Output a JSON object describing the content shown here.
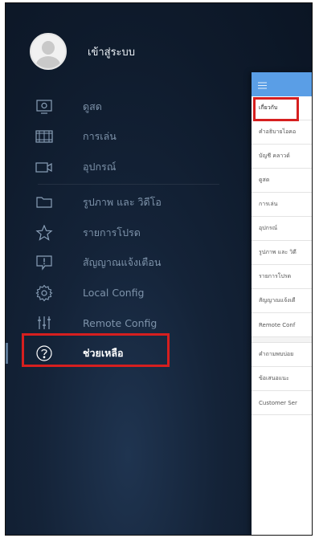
{
  "profile": {
    "login_label": "เข้าสู่ระบบ"
  },
  "menu": {
    "items": [
      {
        "label": "ดูสด",
        "icon": "monitor-icon"
      },
      {
        "label": "การเล่น",
        "icon": "film-icon"
      },
      {
        "label": "อุปกรณ์",
        "icon": "camera-icon"
      },
      {
        "label": "รูปภาพ และ วิดีโอ",
        "icon": "folder-icon"
      },
      {
        "label": "รายการโปรด",
        "icon": "star-icon"
      },
      {
        "label": "สัญญาณแจ้งเตือน",
        "icon": "alert-icon"
      },
      {
        "label": "Local Config",
        "icon": "gear-icon"
      },
      {
        "label": "Remote Config",
        "icon": "sliders-icon"
      },
      {
        "label": "ช่วยเหลือ",
        "icon": "help-icon"
      }
    ]
  },
  "help_panel": {
    "header_icon": "hamburger-icon",
    "items": [
      "เกี่ยวกับ",
      "คำอธิบายไอคอ",
      "บัญชี คลาวด์",
      "ดูสด",
      "การเล่น",
      "อุปกรณ์",
      "รูปภาพ และ วิดี",
      "รายการโปรด",
      "สัญญาณแจ้งเตื",
      "Remote Conf",
      "คำถามพบบ่อย",
      "ข้อเสนอแนะ",
      "Customer Ser"
    ]
  },
  "colors": {
    "background": "#0e1a2b",
    "panel_header": "#5a9ee6",
    "highlight": "#d61f1f",
    "menu_text": "#7e93aa"
  }
}
